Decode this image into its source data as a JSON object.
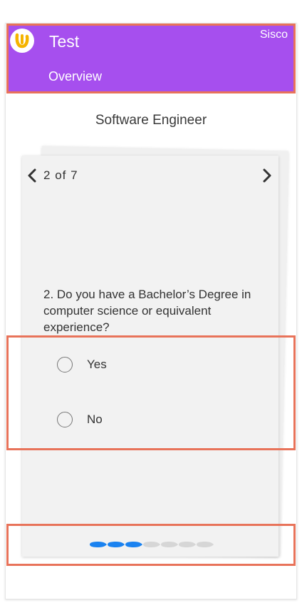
{
  "header": {
    "app_title": "Test",
    "user_name": "Sisco",
    "tab_label": "Overview",
    "background": "#a64fee",
    "logo_icon": "bird-logo-icon"
  },
  "job_title": "Software Engineer",
  "question_card": {
    "pager": {
      "current": "2",
      "of_label": "of",
      "total": "7"
    },
    "question_text": "2. Do you have a Bachelor’s Degree in computer science or equivalent experience?",
    "options": [
      {
        "label": "Yes",
        "selected": false
      },
      {
        "label": "No",
        "selected": false
      }
    ],
    "progress": {
      "completed": 3,
      "total": 7,
      "active_color": "#1a82f0",
      "inactive_color": "#d6d6d6"
    }
  },
  "highlight_color": "#e8735a"
}
